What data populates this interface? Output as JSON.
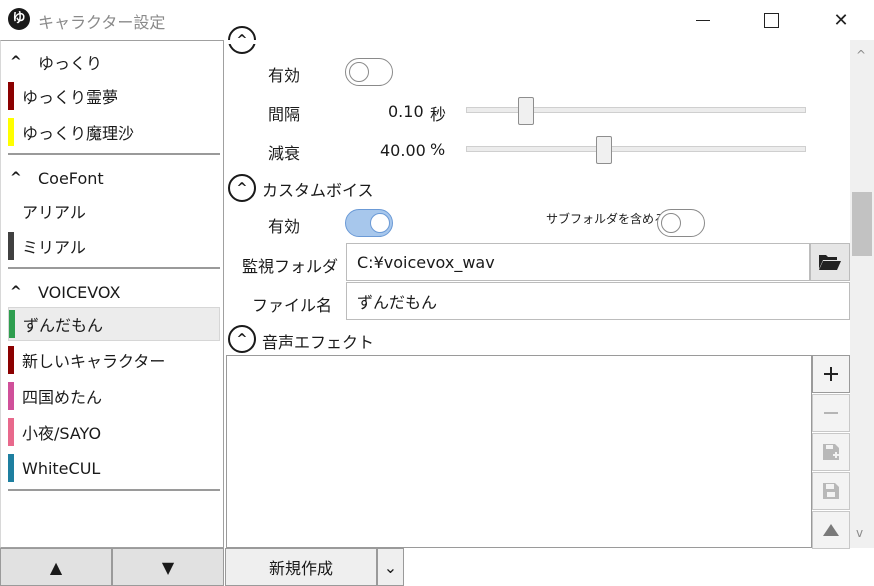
{
  "window": {
    "title": "キャラクター設定",
    "app_icon_glyph": "ゆ",
    "minimize_glyph": "—",
    "close_glyph": "✕"
  },
  "sidebar": {
    "groups": [
      {
        "label": "ゆっくり",
        "items": [
          {
            "label": "ゆっくり霊夢",
            "color": "#8b0000"
          },
          {
            "label": "ゆっくり魔理沙",
            "color": "#ffff00"
          }
        ]
      },
      {
        "label": "CoeFont",
        "items": [
          {
            "label": "アリアル",
            "color": ""
          },
          {
            "label": "ミリアル",
            "color": "#404040"
          }
        ]
      },
      {
        "label": "VOICEVOX",
        "items": [
          {
            "label": "ずんだもん",
            "color": "#2e9e4f",
            "selected": true
          },
          {
            "label": "新しいキャラクター",
            "color": "#8b0000"
          },
          {
            "label": "四国めたん",
            "color": "#d0509a"
          },
          {
            "label": "小夜/SAYO",
            "color": "#e8698c"
          },
          {
            "label": "WhiteCUL",
            "color": "#1e7fa0"
          }
        ]
      }
    ],
    "move_up_glyph": "▲",
    "move_down_glyph": "▼",
    "new_button_label": "新規作成",
    "new_dropdown_glyph": "⌄"
  },
  "echo": {
    "enabled_label": "有効",
    "enabled": false,
    "interval_label": "間隔",
    "interval_value": "0.10",
    "interval_unit": "秒",
    "interval_fraction": 0.16,
    "decay_label": "減衰",
    "decay_value": "40.00",
    "decay_unit": "%",
    "decay_fraction": 0.4
  },
  "custom_voice": {
    "header": "カスタムボイス",
    "enabled_label": "有効",
    "enabled": true,
    "subfolder_label": "サブフォルダを含める",
    "subfolder_enabled": false,
    "watch_folder_label": "監視フォルダ",
    "watch_folder_value": "C:¥voicevox_wav",
    "file_name_label": "ファイル名",
    "file_name_value": "ずんだもん"
  },
  "sound_effect": {
    "header": "音声エフェクト"
  },
  "icons": {
    "expander": "chevron-up-icon",
    "folder": "folder-open-icon",
    "add": "plus-icon",
    "remove": "minus-icon"
  }
}
